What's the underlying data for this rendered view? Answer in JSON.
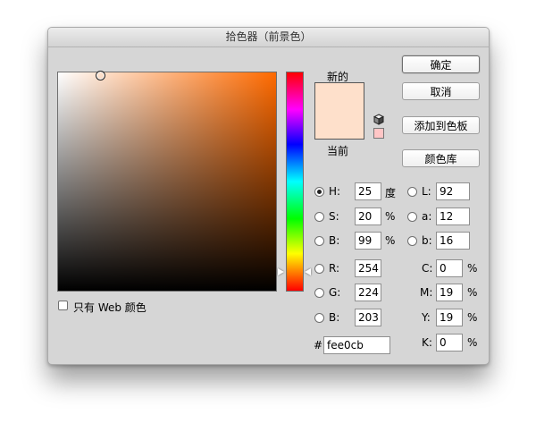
{
  "title": "拾色器（前景色）",
  "swatch": {
    "new_label": "新的",
    "current_label": "当前",
    "new_color": "#fee0cb",
    "current_color": "#fee0cb",
    "alt_color": "#ffc6c6"
  },
  "buttons": {
    "ok": "确定",
    "cancel": "取消",
    "add_to_swatches": "添加到色板",
    "color_libraries": "颜色库"
  },
  "web_only_label": "只有 Web 颜色",
  "hsb": {
    "h": {
      "label": "H:",
      "value": "25",
      "unit": "度"
    },
    "s": {
      "label": "S:",
      "value": "20",
      "unit": "%"
    },
    "b": {
      "label": "B:",
      "value": "99",
      "unit": "%"
    }
  },
  "rgb": {
    "r": {
      "label": "R:",
      "value": "254"
    },
    "g": {
      "label": "G:",
      "value": "224"
    },
    "b": {
      "label": "B:",
      "value": "203"
    }
  },
  "lab": {
    "l": {
      "label": "L:",
      "value": "92"
    },
    "a": {
      "label": "a:",
      "value": "12"
    },
    "b": {
      "label": "b:",
      "value": "16"
    }
  },
  "cmyk": {
    "c": {
      "label": "C:",
      "value": "0",
      "unit": "%"
    },
    "m": {
      "label": "M:",
      "value": "19",
      "unit": "%"
    },
    "y": {
      "label": "Y:",
      "value": "19",
      "unit": "%"
    },
    "k": {
      "label": "K:",
      "value": "0",
      "unit": "%"
    }
  },
  "hex": {
    "label": "#",
    "value": "fee0cb"
  },
  "icons": {
    "gamut_cube": "cube-icon",
    "hue_slider_arrows": "triangle-icon"
  }
}
